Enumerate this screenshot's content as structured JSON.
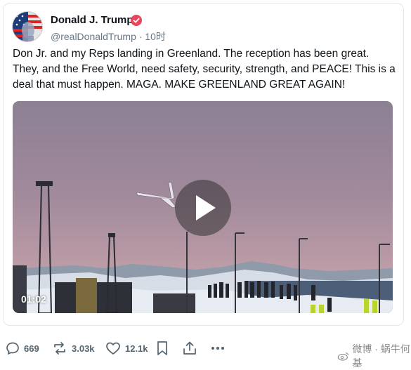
{
  "post": {
    "author_name": "Donald J. Trump",
    "handle": "@realDonaldTrump",
    "separator": "·",
    "time": "10时",
    "text": "Don Jr. and my Reps landing in Greenland. The reception has been great. They, and the Free World, need safety, security, strength, and PEACE! This is a deal that must happen. MAGA. MAKE GREENLAND GREAT AGAIN!",
    "video": {
      "duration": "01:02"
    }
  },
  "actions": {
    "replies": "669",
    "reposts": "3.03k",
    "likes": "12.1k"
  },
  "watermark": {
    "text": "微博 · 蜗牛何基"
  },
  "colors": {
    "verified": "#e8465c",
    "text": "#0f1419",
    "secondary": "#687684"
  },
  "icons": [
    "verified-badge-icon",
    "play-icon",
    "reply-icon",
    "repost-icon",
    "like-icon",
    "bookmark-icon",
    "share-icon",
    "more-icon",
    "weibo-logo-icon"
  ]
}
